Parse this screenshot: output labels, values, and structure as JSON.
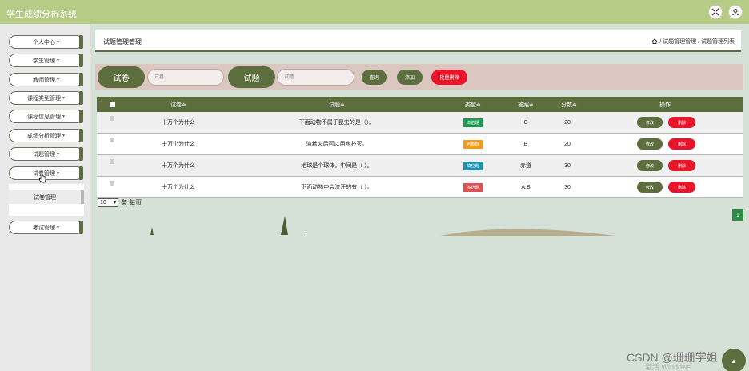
{
  "app": {
    "title": "学生成绩分析系统"
  },
  "header": {
    "icons": [
      "fullscreen-icon",
      "user-icon"
    ]
  },
  "sidebar": {
    "items": [
      {
        "label": "个人中心",
        "caret": "▾"
      },
      {
        "label": "学生管理",
        "caret": "▾"
      },
      {
        "label": "教师管理",
        "caret": "▾"
      },
      {
        "label": "课程类型管理",
        "caret": "▾"
      },
      {
        "label": "课程信息管理",
        "caret": "▾"
      },
      {
        "label": "成绩分析管理",
        "caret": "▾"
      },
      {
        "label": "试题管理",
        "caret": "▾"
      },
      {
        "label": "试卷管理",
        "caret": "▾"
      },
      {
        "label": "考试管理",
        "caret": "▾"
      }
    ],
    "submenu": [
      {
        "label": "试卷管理"
      }
    ]
  },
  "page": {
    "title": "试题管理管理",
    "breadcrumb": "/ 试题管理管理 / 试题管理列表"
  },
  "search": {
    "paper_label": "试卷",
    "paper_placeholder": "试卷",
    "question_label": "试题",
    "question_placeholder": "试题",
    "query_button": "查询",
    "add_button": "添加",
    "batch_delete_button": "批量删除"
  },
  "table": {
    "headers": [
      "试卷≑",
      "试题≑",
      "类型≑",
      "答案≑",
      "分数≑",
      "操作"
    ],
    "rows": [
      {
        "paper": "十万个为什么",
        "question": "下面动物不属于昆虫的是（）。",
        "type": "单选题",
        "answer": "C",
        "score": "20",
        "edit": "修改",
        "delete": "删除"
      },
      {
        "paper": "十万个为什么",
        "question": "油着火后可以用水扑灭。",
        "type": "判断题",
        "answer": "B",
        "score": "20",
        "edit": "修改",
        "delete": "删除"
      },
      {
        "paper": "十万个为什么",
        "question": "地球是个球体，中间是（ ）。",
        "type": "填空题",
        "answer": "赤道",
        "score": "30",
        "edit": "修改",
        "delete": "删除"
      },
      {
        "paper": "十万个为什么",
        "question": "下面动物中会流汗的有（ ）。",
        "type": "多选题",
        "answer": "A,B",
        "score": "30",
        "edit": "修改",
        "delete": "删除"
      }
    ]
  },
  "pagination": {
    "page_size": "10",
    "per_page_text": "条 每页",
    "current_page": "1"
  },
  "colors": {
    "topbar": "#b6cc86",
    "accent": "#5d6e3e",
    "danger": "#e8142a",
    "type_single": "#1e9a52",
    "type_judge": "#f39a1b",
    "type_fill": "#1f8fae",
    "type_multi": "#e35052"
  },
  "watermarks": {
    "csdn": "CSDN @珊珊学姐",
    "windows": "激活 Windows"
  }
}
